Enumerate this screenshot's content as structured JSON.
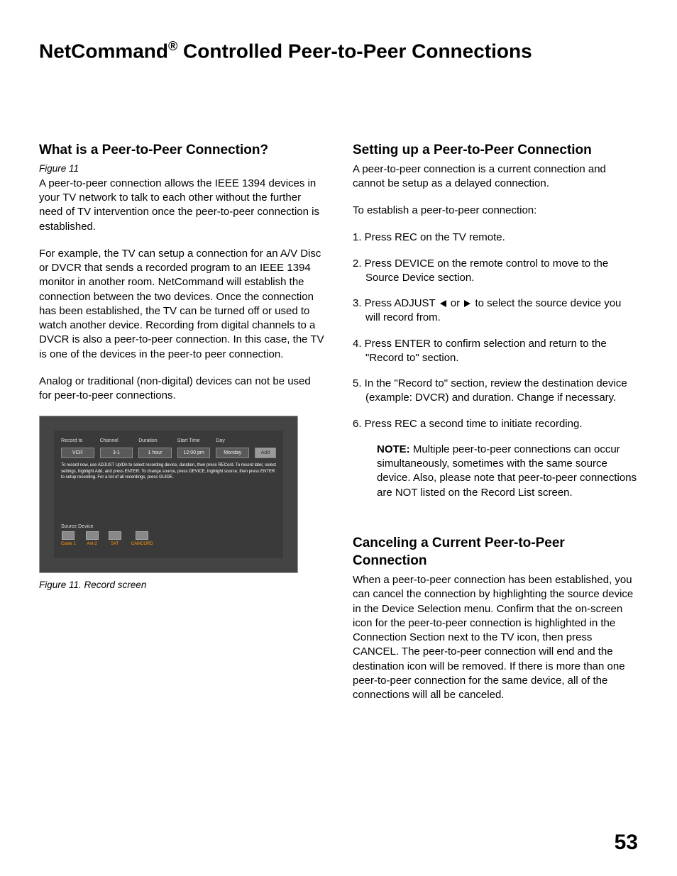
{
  "title_prefix": "NetCommand",
  "title_suffix": " Controlled Peer-to-Peer Connections",
  "left": {
    "heading": "What is a Peer-to-Peer Connection?",
    "figref": "Figure 11",
    "p1": "A peer-to-peer connection allows the IEEE 1394 devices in your TV network to talk to each other without the further need of TV intervention once the peer-to-peer connection is established.",
    "p2": "For example, the TV can setup a connection for an A/V Disc or DVCR that sends a recorded program to an IEEE 1394 monitor in another room.  NetCommand will establish the connection between the two devices.  Once the connection has been established, the TV can be turned off or used to watch another device.  Recording from digital channels to a DVCR is also a peer-to-peer connection.  In this case, the TV is one of the devices in the peer-to peer connection.",
    "p3": "Analog or traditional (non-digital) devices can not be used for peer-to-peer connections.",
    "figure": {
      "headers": [
        "Record to",
        "Channel",
        "Duration",
        "Start Time",
        "Day"
      ],
      "values": [
        "VCR",
        "3-1",
        "1 hour",
        "12:00 pm",
        "Monday"
      ],
      "add": "Add",
      "note": "To record now, use ADJUST Up/Dn to select recording device, duration, then press RECord.  To record later, select settings, highlight Add, and press ENTER.  To change source, press DEVICE, highlight source, then press ENTER to setup recording.  For a list of all recordings, press GUIDE.",
      "devicesLabel": "Source Device",
      "devices": [
        "Cable 1",
        "Ant-2",
        "SAT",
        "CAMCORD"
      ]
    },
    "figcaption": "Figure 11. Record screen"
  },
  "right": {
    "heading1": "Setting up a Peer-to-Peer Connection",
    "p1": "A peer-to-peer connection is a current connection and cannot be setup as a delayed connection.",
    "p2": "To establish a peer-to-peer connection:",
    "steps": {
      "s1": "1. Press REC on the TV remote.",
      "s2": "2.  Press DEVICE on the remote control to move to the Source Device section.",
      "s3a": "3. Press ADJUST ",
      "s3mid": " or ",
      "s3b": " to select the source device you will record from.",
      "s4": "4. Press ENTER to confirm selection and return to the \"Record to\" section.",
      "s5": "5. In the \"Record to\" section, review the destination device (example: DVCR) and duration.  Change if necessary.",
      "s6": "6.  Press REC a second time to initiate recording."
    },
    "noteLabel": "NOTE:",
    "noteBody": "  Multiple peer-to-peer connections can occur simultaneously, sometimes with the same source device.  Also, please note that peer-to-peer connections are NOT listed on the Record List screen.",
    "heading2": "Canceling a Current Peer-to-Peer Connection",
    "p3": "When a peer-to-peer connection has been established, you can cancel the connection by highlighting the source device in the Device Selection menu.  Confirm that the on-screen icon for the peer-to-peer connection is highlighted in the Connection Section next to the TV icon, then press  CANCEL.  The peer-to-peer connection will end and the destination icon will be removed.  If there is more than one peer-to-peer connection for the same device, all of the connections will all be canceled."
  },
  "pageNumber": "53"
}
